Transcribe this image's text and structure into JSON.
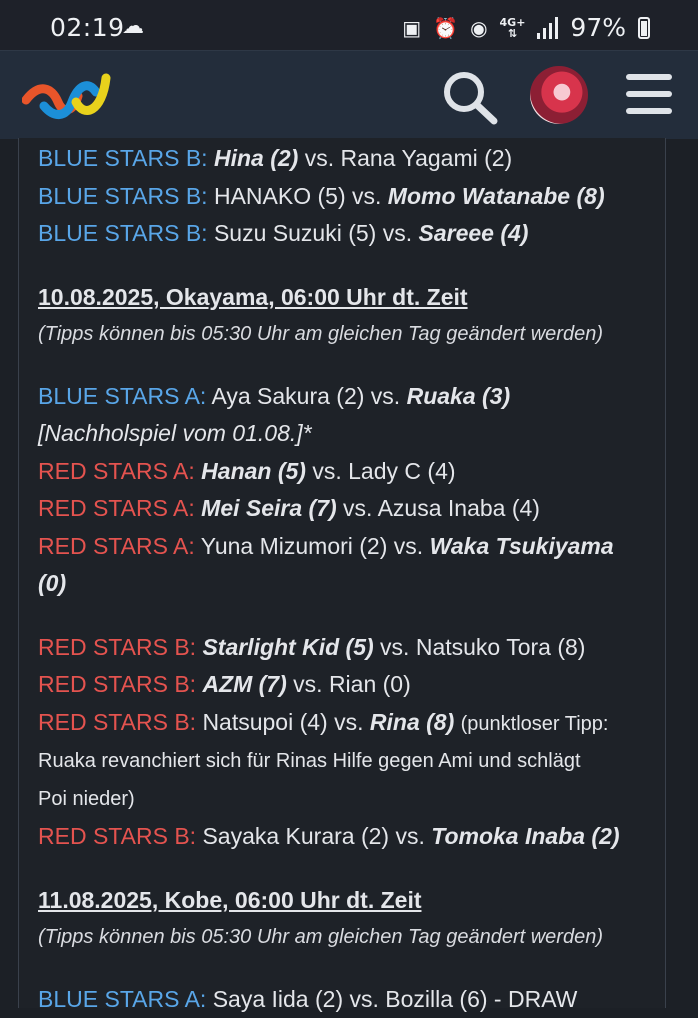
{
  "status_bar": {
    "time": "02:19",
    "network": "4G+",
    "battery": "97%"
  },
  "header": {
    "logo": "wave-logo-icon",
    "search": "search-icon",
    "avatar": "user-avatar",
    "menu": "hamburger-menu-icon"
  },
  "colors": {
    "blue_team": "#59a6e8",
    "red_team": "#e4534f",
    "background": "#1c2026",
    "header": "#232d3b"
  },
  "matches_top": [
    {
      "team": "BLUE STARS B:",
      "a": "Hina (2)",
      "vs": " vs. ",
      "b": "Rana Yagami (2)"
    },
    {
      "team": "BLUE STARS B:",
      "a": "HANAKO (5)",
      "vs": " vs. ",
      "b": "Momo Watanabe (8)"
    },
    {
      "team": "BLUE STARS B:",
      "a": "Suzu Suzuki (5)",
      "vs": " vs. ",
      "b": "Sareee (4)"
    }
  ],
  "event1": {
    "date": "10.08.2025, Okayama, 06:00 Uhr dt. Zeit",
    "hint": "(Tipps können bis 05:30 Uhr am gleichen Tag geändert werden)",
    "blue_a": {
      "team": "BLUE STARS A:",
      "a": "Aya Sakura (2)",
      "vs": " vs. ",
      "b": "Ruaka (3)",
      "extra": "[Nachholspiel vom 01.08.]*"
    },
    "red_a": [
      {
        "team": "RED STARS A:",
        "a": "Hanan (5)",
        "vs": " vs. ",
        "b": "Lady C (4)"
      },
      {
        "team": "RED STARS A:",
        "a": "Mei Seira (7)",
        "vs": " vs. ",
        "b": "Azusa Inaba (4)"
      },
      {
        "team": "RED STARS A:",
        "a": "Yuna Mizumori (2)",
        "vs": " vs. ",
        "b": "Waka Tsukiyama",
        "b2": "(0)"
      }
    ],
    "red_b": [
      {
        "team": "RED STARS B:",
        "a": "Starlight Kid (5)",
        "vs": " vs. ",
        "b": "Natsuko Tora (8)"
      },
      {
        "team": "RED STARS B:",
        "a": "AZM (7)",
        "vs": " vs. ",
        "b": "Rian (0)"
      },
      {
        "team": "RED STARS B:",
        "a": "Natsupoi (4)",
        "vs": " vs. ",
        "b": "Rina (8)",
        "note": "(punktloser Tipp:",
        "note2": "Ruaka revanchiert sich für Rinas Hilfe gegen Ami und schlägt",
        "note3": "Poi nieder)"
      },
      {
        "team": "RED STARS B:",
        "a": "Sayaka Kurara (2)",
        "vs": " vs. ",
        "b": "Tomoka Inaba (2)"
      }
    ]
  },
  "event2": {
    "date": "11.08.2025, Kobe, 06:00 Uhr dt. Zeit",
    "hint": "(Tipps können bis 05:30 Uhr am gleichen Tag geändert werden)",
    "first": {
      "team": "BLUE STARS A:",
      "a": "Saya Iida (2)",
      "vs": " vs. ",
      "b": "Bozilla (6) - DRAW"
    }
  }
}
